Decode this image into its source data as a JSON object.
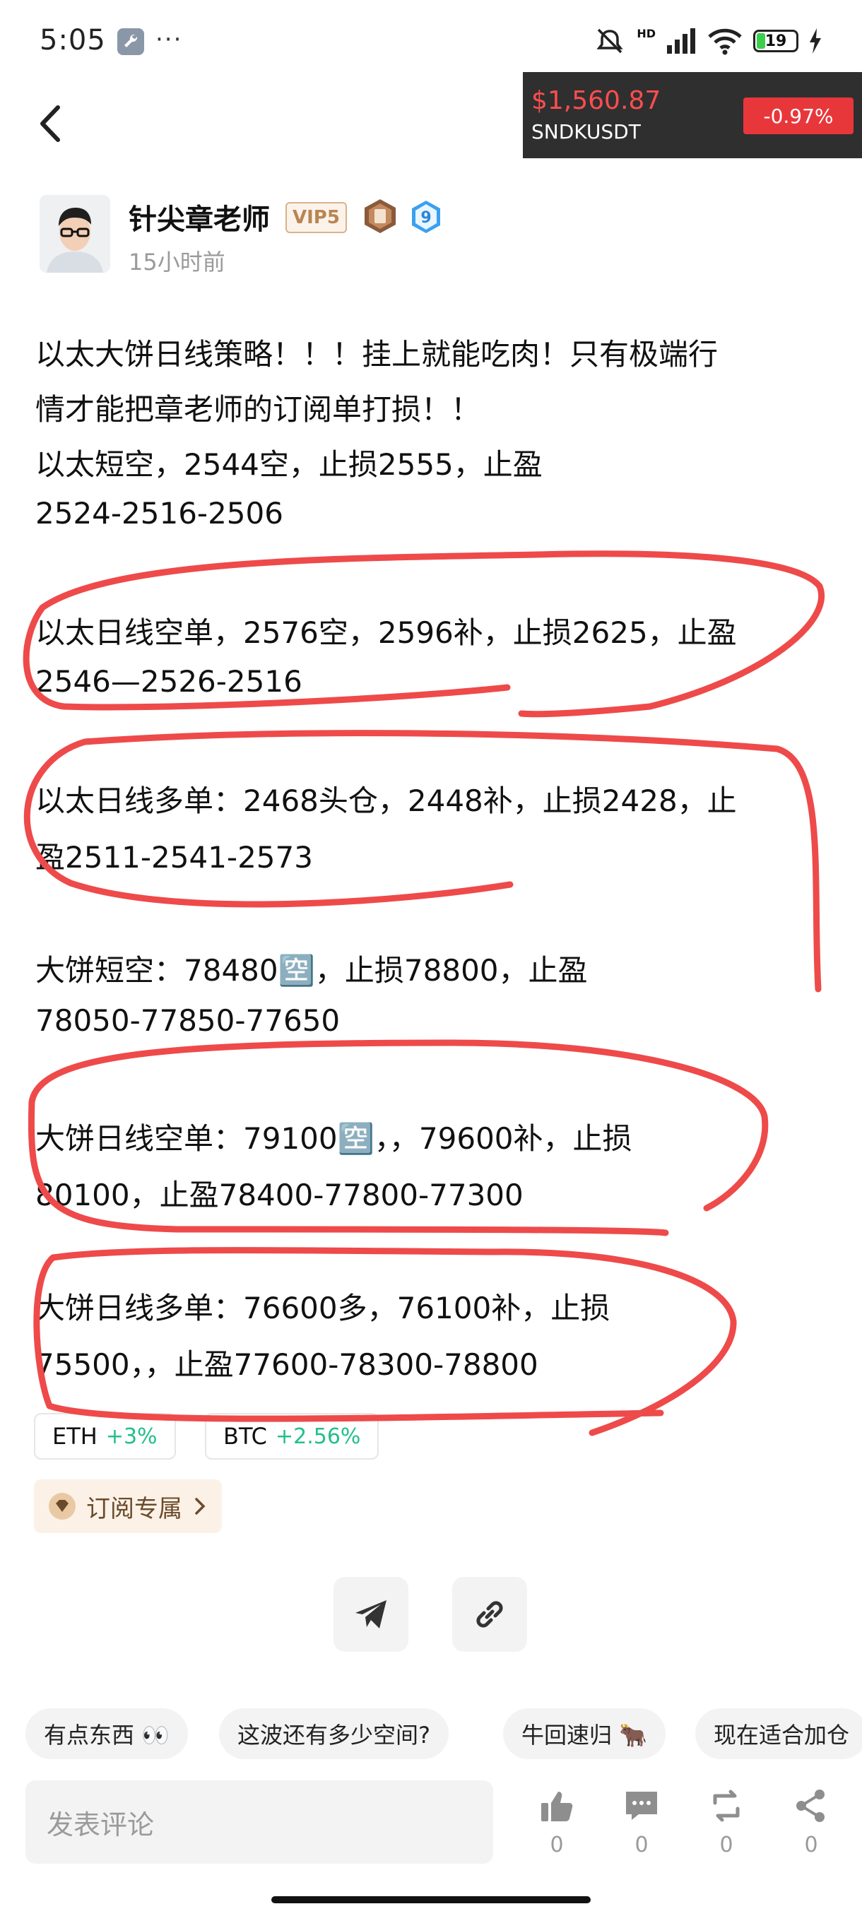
{
  "status": {
    "time": "5:05",
    "more": "···",
    "net": "HD",
    "battery": "19"
  },
  "ticker": {
    "price": "$1,560.87",
    "symbol": "SNDKUSDT",
    "change": "-0.97%"
  },
  "author": {
    "name": "针尖章老师",
    "vip": "VIP5",
    "level": "9",
    "time": "15小时前"
  },
  "post": {
    "lines": [
      "以太大饼日线策略！！！挂上就能吃肉！只有极端行",
      "情才能把章老师的订阅单打损！！",
      "以太短空，2544空，止损2555，止盈",
      "2524-2516-2506",
      "以太日线空单，2576空，2596补，止损2625，止盈",
      "2546—2526-2516",
      "以太日线多单：2468头仓，2448补，止损2428，止",
      "盈2511-2541-2573",
      "大饼短空：78480🈳，止损78800，止盈",
      "78050-77850-77650",
      "大饼日线空单：79100🈳，，79600补，止损",
      "80100，止盈78400-77800-77300",
      "大饼日线多单：76600多，76100补，止损",
      "75500，，止盈77600-78300-78800"
    ]
  },
  "tags": [
    {
      "symbol": "ETH",
      "change": "+3%"
    },
    {
      "symbol": "BTC",
      "change": "+2.56%"
    }
  ],
  "subscription": {
    "label": "订阅专属"
  },
  "quick_replies": [
    "有点东西 👀",
    "这波还有多少空间?",
    "牛回速归 🐂",
    "现在适合加仓"
  ],
  "comment": {
    "placeholder": "发表评论"
  },
  "actions": {
    "like": "0",
    "comment": "0",
    "repost": "0",
    "share": "0"
  },
  "colors": {
    "annotation": "#ee4a4a",
    "accent_green": "#22c08a",
    "ticker_red": "#ff4d4f"
  }
}
